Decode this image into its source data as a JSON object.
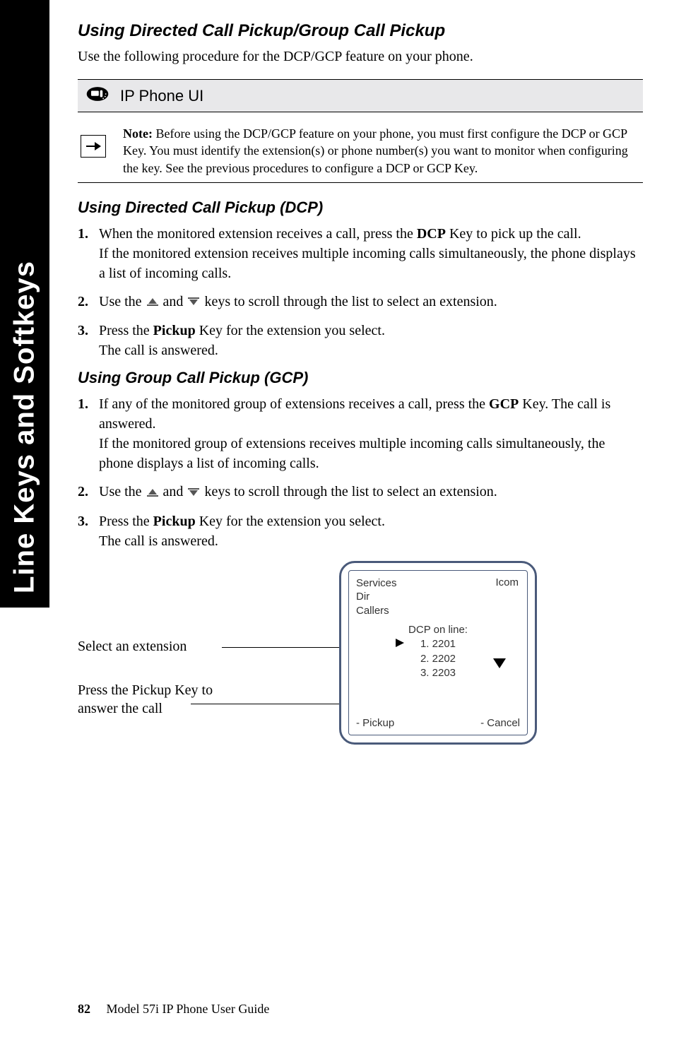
{
  "sideTab": "Line Keys and Softkeys",
  "title": "Using Directed Call Pickup/Group Call Pickup",
  "intro": "Use the following procedure for the DCP/GCP feature on your phone.",
  "uiBarLabel": "IP Phone UI",
  "note": {
    "label": "Note:",
    "text": " Before using the DCP/GCP feature on your phone, you must first configure the DCP or GCP Key. You must identify the extension(s) or phone number(s) you want to monitor when configuring the key. See the previous procedures to configure a DCP or GCP Key."
  },
  "dcp": {
    "heading": "Using Directed Call Pickup (DCP)",
    "steps": [
      {
        "num": "1.",
        "pre": "When the monitored extension receives a call, press the ",
        "bold": "DCP",
        "post": " Key to pick up the call.",
        "extra": "If the monitored extension receives multiple incoming calls simultaneously, the phone displays a list of incoming calls."
      },
      {
        "num": "2.",
        "pre": "Use the ",
        "mid": " and ",
        "post": " keys to scroll through the list to select an extension.",
        "arrows": true
      },
      {
        "num": "3.",
        "pre": "Press the ",
        "bold": "Pickup",
        "post": " Key for the extension you select.",
        "extra": "The call is answered."
      }
    ]
  },
  "gcp": {
    "heading": "Using Group Call Pickup (GCP)",
    "steps": [
      {
        "num": "1.",
        "pre": "If any of the monitored group of extensions receives a call, press the ",
        "bold": "GCP",
        "post": " Key. The call is answered.",
        "extra": "If the monitored group of extensions receives multiple incoming calls simultaneously, the phone displays a list of incoming calls."
      },
      {
        "num": "2.",
        "pre": "Use the ",
        "mid": " and ",
        "post": " keys to scroll through the list to select an extension.",
        "arrows": true
      },
      {
        "num": "3.",
        "pre": "Press the ",
        "bold": "Pickup",
        "post": " Key for the extension you select.",
        "extra": "The call is answered."
      }
    ]
  },
  "diagram": {
    "label1": "Select an extension",
    "label2": "Press the Pickup Key to answer the call",
    "screen": {
      "topItems": [
        "Services",
        "Dir",
        "Callers"
      ],
      "topRight": "Icom",
      "centerTitle": "DCP on line:",
      "items": [
        "1. 2201",
        "2. 2202",
        "3. 2203"
      ],
      "bottomLeft": "- Pickup",
      "bottomRight": "- Cancel"
    }
  },
  "footer": {
    "page": "82",
    "text": "Model 57i IP Phone User Guide"
  }
}
